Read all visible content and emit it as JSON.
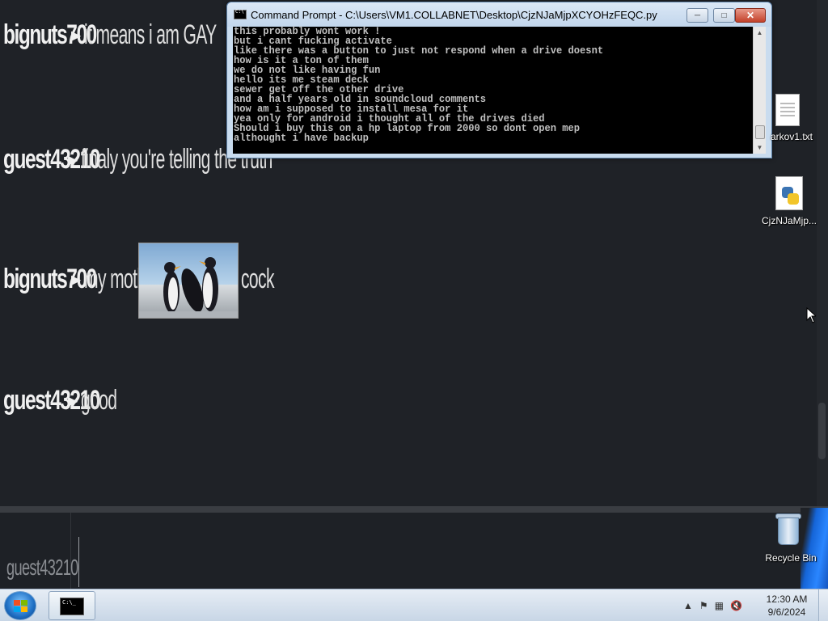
{
  "chat": {
    "messages": [
      {
        "user": "bignuts700",
        "text": "it means i am GAY"
      },
      {
        "user": "guest43210",
        "text": "finaly you're telling the truth"
      },
      {
        "user": "bignuts700",
        "text_before": "my mother is",
        "text_after": "cock",
        "image": "penguins"
      },
      {
        "user": "guest43210",
        "text": "good"
      }
    ]
  },
  "input": {
    "username": "guest43210",
    "value": ""
  },
  "cmd_window": {
    "title": "Command Prompt - C:\\Users\\VM1.COLLABNET\\Desktop\\CjzNJaMjpXCYOHzFEQC.py",
    "lines": [
      "this probably wont work !",
      "but i cant fucking activate",
      "like there was a button to just not respond when a drive doesnt",
      "how is it a ton of them",
      "we do not like having fun",
      "hello its me steam deck",
      "sewer get off the other drive",
      "and a half years old in soundcloud comments",
      "how am i supposed to install mesa for it",
      "yea only for android i thought all of the drives died",
      "Should i buy this on a hp laptop from 2000 so dont open mep",
      "althought i have backup"
    ]
  },
  "desktop_icons": [
    {
      "label": "arkov1.txt",
      "icon": "text-file-icon"
    },
    {
      "label": "CjzNJaMjp...",
      "icon": "python-file-icon"
    },
    {
      "label": "Recycle Bin",
      "icon": "recycle-bin-icon"
    }
  ],
  "taskbar": {
    "time": "12:30 AM",
    "date": "9/6/2024"
  },
  "colors": {
    "chat_bg": "#1f2227",
    "taskbar_bg": "#d6e2ef",
    "cmd_bg": "#000000",
    "close_button": "#c3412a"
  }
}
